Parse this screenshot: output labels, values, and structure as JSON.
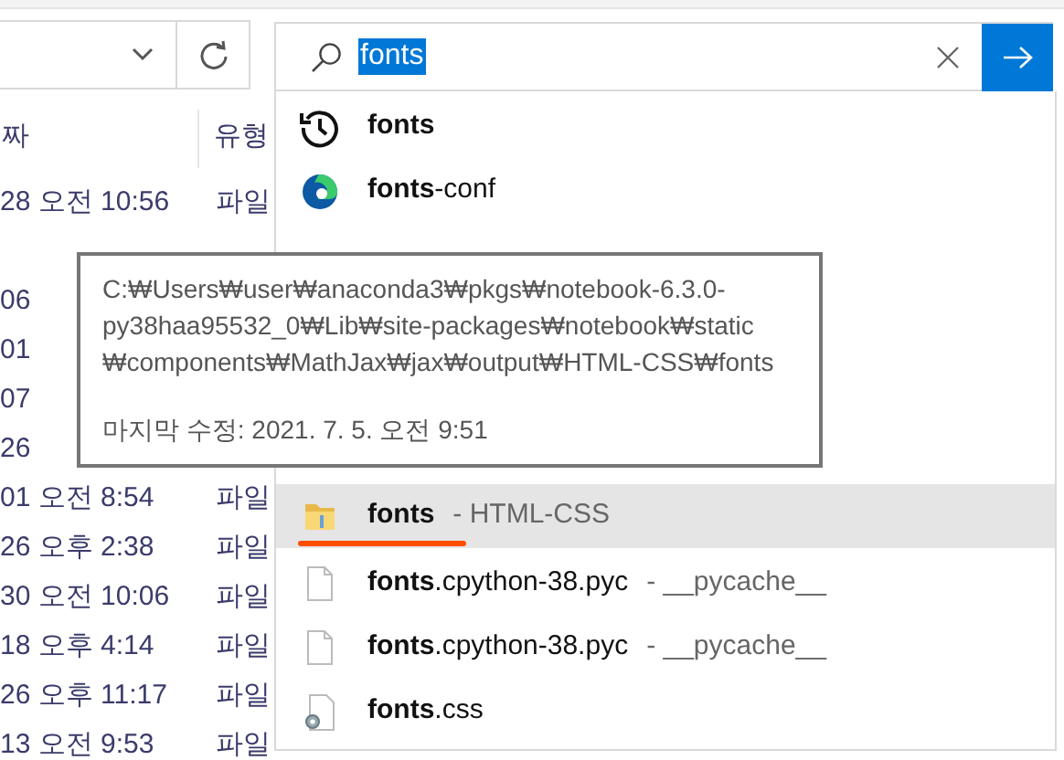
{
  "address_bar": {
    "refresh": true
  },
  "columns": [
    "짜",
    "유형"
  ],
  "rows": [
    {
      "date": "28 오전 10:56",
      "type": "파일"
    },
    {
      "date": "06"
    },
    {
      "date": "01"
    },
    {
      "date": "07"
    },
    {
      "date": "26"
    },
    {
      "date": "01 오전 8:54",
      "type": "파일"
    },
    {
      "date": "26 오후 2:38",
      "type": "파일"
    },
    {
      "date": "30 오전 10:06",
      "type": "파일"
    },
    {
      "date": "18 오후 4:14",
      "type": "파일"
    },
    {
      "date": "26 오후 11:17",
      "type": "파일"
    },
    {
      "date": "13 오전 9:53",
      "type": "파일"
    }
  ],
  "search": {
    "value": "fonts"
  },
  "suggestions": [
    {
      "kind": "history",
      "match": "fonts",
      "selected": false
    },
    {
      "kind": "edge",
      "match": "fonts",
      "rest": "-conf",
      "selected": false
    },
    {
      "kind": "folder",
      "match": "fonts",
      "location": "- HTML-CSS",
      "selected": true
    },
    {
      "kind": "file",
      "match": "fonts",
      "rest": ".cpython-38.pyc",
      "location": "- __pycache__",
      "selected": false
    },
    {
      "kind": "file",
      "match": "fonts",
      "rest": ".cpython-38.pyc",
      "location": "- __pycache__",
      "selected": false
    },
    {
      "kind": "css",
      "match": "fonts",
      "rest": ".css",
      "selected": false
    }
  ],
  "tooltip": {
    "path_lines": [
      "C:₩Users₩user₩anaconda3₩pkgs₩notebook-6.3.0-",
      "py38haa95532_0₩Lib₩site-packages₩notebook₩static",
      "₩components₩MathJax₩jax₩output₩HTML-CSS₩fonts"
    ],
    "modified": "마지막 수정: 2021. 7. 5. 오전 9:51"
  }
}
